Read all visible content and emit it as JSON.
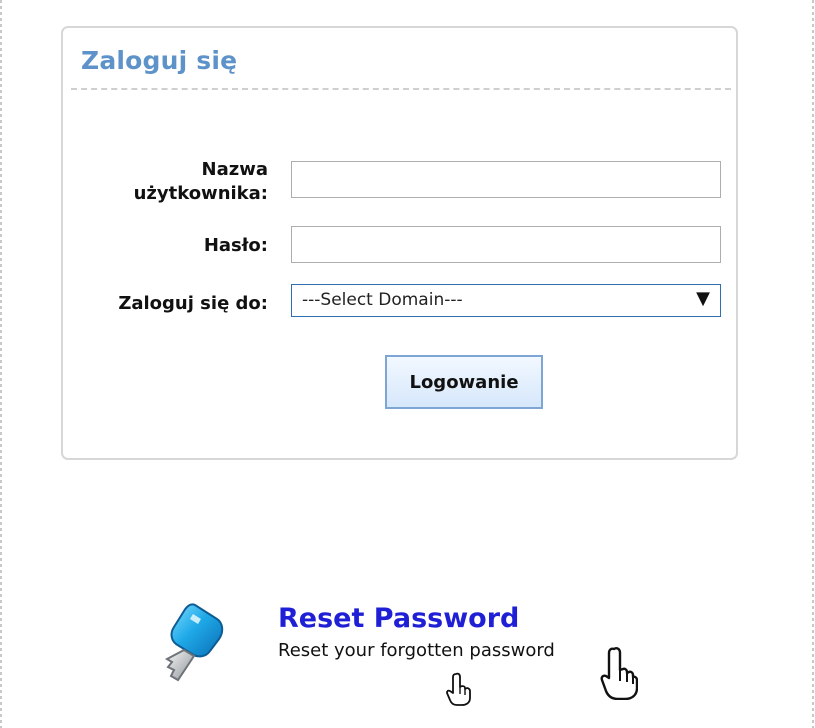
{
  "login": {
    "title": "Zaloguj się",
    "username_label_line1": "Nazwa",
    "username_label_line2": "użytkownika:",
    "username_value": "",
    "password_label": "Hasło:",
    "password_value": "",
    "domain_label": "Zaloguj się do:",
    "domain_selected": "---Select Domain---",
    "submit_label": "Logowanie"
  },
  "reset": {
    "link_label": "Reset Password",
    "description": "Reset your forgotten password"
  },
  "colors": {
    "title": "#5d93c9",
    "reset_link": "#1f1fd6",
    "button_border": "#7ea6d4"
  },
  "icons": {
    "key": "key-icon",
    "dropdown": "dropdown-arrow-icon",
    "cursor": "hand-pointer-icon"
  }
}
